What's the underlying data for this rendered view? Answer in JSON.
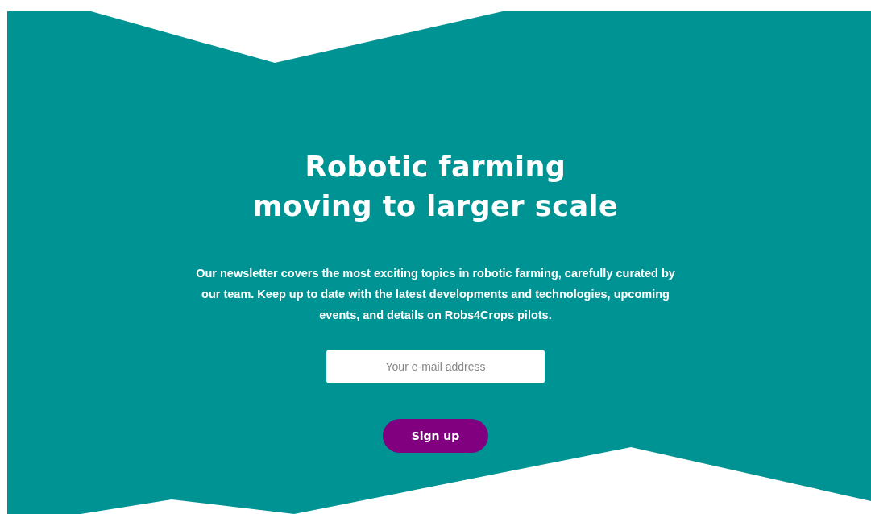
{
  "hero": {
    "title_lines": [
      "Robotic farming",
      "moving to larger scale"
    ],
    "description": "Our newsletter covers the most exciting topics in robotic farming, carefully curated by our team. Keep up to date with the latest developments and technologies, upcoming events, and details on Robs4Crops pilots.",
    "email_field": {
      "placeholder": "Your e-mail address"
    },
    "button": "Sign up"
  }
}
